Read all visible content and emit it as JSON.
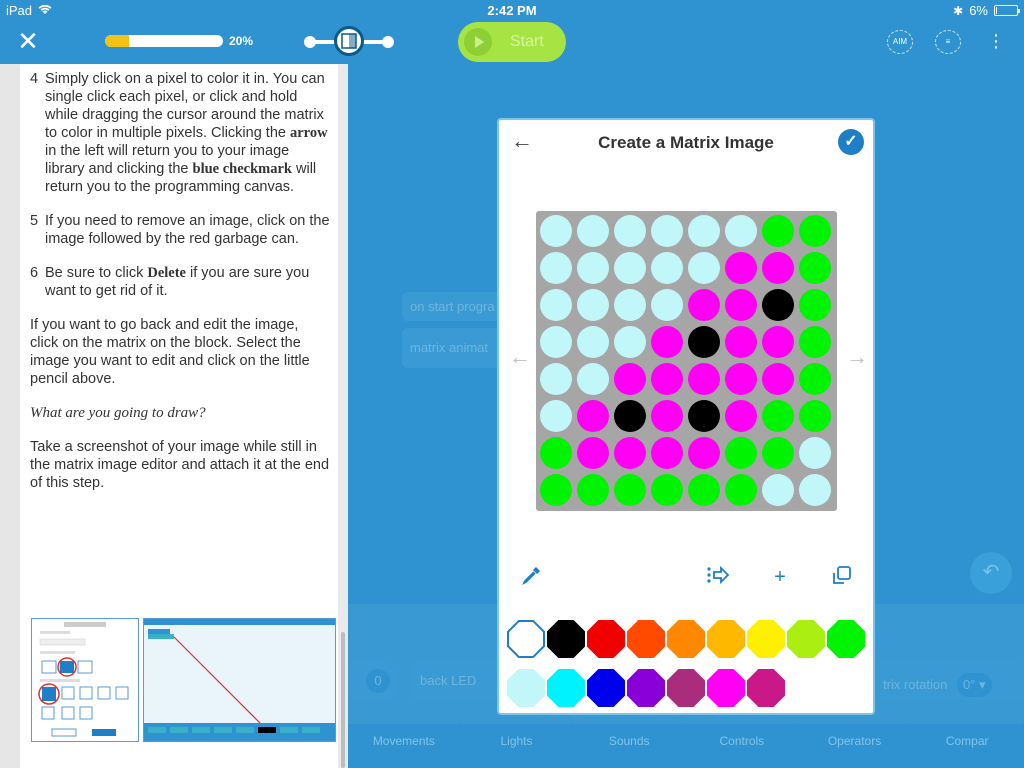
{
  "status_bar": {
    "device": "iPad",
    "time": "2:42 PM",
    "battery": "6%",
    "battery_level": 0.06
  },
  "toolbar": {
    "close_icon": "close-icon",
    "progress_value": 0.2,
    "progress_text": "20%",
    "start_label": "Start",
    "aim_label": "AIM",
    "colors": {
      "bar": "#2f93d1",
      "progress": "#f2c316",
      "start": "#a6e444"
    }
  },
  "instructions": {
    "steps": [
      {
        "num": "4",
        "parts": [
          "Simply click on a pixel to color it in. You can single click each pixel, or click and hold while dragging the cursor around the matrix to color in multiple pixels. Clicking the ",
          "arrow",
          " in the left will return you to your image library and clicking the ",
          "blue checkmark",
          " will return you to the programming canvas."
        ]
      },
      {
        "num": "5",
        "parts": [
          "If you need to remove an image, click on the image followed by the red garbage can."
        ]
      },
      {
        "num": "6",
        "parts": [
          "Be sure to click ",
          "Delete",
          " if you are sure you want to get rid of it."
        ]
      }
    ],
    "para1": "If you want to go back and edit the image, click on the matrix on the block. Select the image you want to edit and click on the little pencil above.",
    "question": "What are you going to draw?",
    "para2": "Take a screenshot of your image while still in the matrix image editor and attach it at the end of this step."
  },
  "canvas": {
    "block1": "on start progra",
    "block2": "matrix animat",
    "block3": "back LED",
    "block4": "trix rotation",
    "block_value": "0",
    "rotation_value": "0°",
    "tabs": [
      "Movements",
      "Lights",
      "Sounds",
      "Controls",
      "Operators",
      "Compar"
    ]
  },
  "modal": {
    "title": "Create a Matrix Image",
    "matrix": [
      [
        "#c1f7f8",
        "#c1f7f8",
        "#c1f7f8",
        "#c1f7f8",
        "#c1f7f8",
        "#c1f7f8",
        "#00f300",
        "#00f300"
      ],
      [
        "#c1f7f8",
        "#c1f7f8",
        "#c1f7f8",
        "#c1f7f8",
        "#c1f7f8",
        "#ff00f4",
        "#ff00f4",
        "#00f300"
      ],
      [
        "#c1f7f8",
        "#c1f7f8",
        "#c1f7f8",
        "#c1f7f8",
        "#ff00f4",
        "#ff00f4",
        "#000000",
        "#00f300"
      ],
      [
        "#c1f7f8",
        "#c1f7f8",
        "#c1f7f8",
        "#ff00f4",
        "#000000",
        "#ff00f4",
        "#ff00f4",
        "#00f300"
      ],
      [
        "#c1f7f8",
        "#c1f7f8",
        "#ff00f4",
        "#ff00f4",
        "#ff00f4",
        "#ff00f4",
        "#ff00f4",
        "#00f300"
      ],
      [
        "#c1f7f8",
        "#ff00f4",
        "#000000",
        "#ff00f4",
        "#000000",
        "#ff00f4",
        "#00f300",
        "#00f300"
      ],
      [
        "#00f300",
        "#ff00f4",
        "#ff00f4",
        "#ff00f4",
        "#ff00f4",
        "#00f300",
        "#00f300",
        "#c1f7f8"
      ],
      [
        "#00f300",
        "#00f300",
        "#00f300",
        "#00f300",
        "#00f300",
        "#00f300",
        "#c1f7f8",
        "#c1f7f8"
      ]
    ],
    "palette_row1": [
      "#ffffff",
      "#000000",
      "#f10000",
      "#ff4a00",
      "#ff8800",
      "#ffb800",
      "#ffef00",
      "#aaef11",
      "#00f300"
    ],
    "palette_row2": [
      "#c1f7f8",
      "#00f2ff",
      "#0000ef",
      "#8800d7",
      "#aa2d7d",
      "#ff00f4",
      "#c91887"
    ],
    "selected_swatch": 0,
    "tools": [
      "eyedropper-icon",
      "import-icon",
      "add-icon",
      "rotate-icon"
    ]
  }
}
